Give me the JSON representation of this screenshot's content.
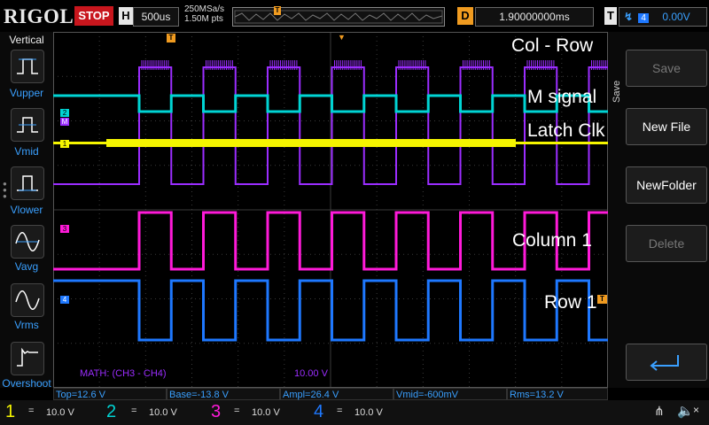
{
  "topbar": {
    "logo": "RIGOL",
    "run_state": "STOP",
    "timebase_tag": "H",
    "timebase_value": "500us",
    "sample_rate": "250MSa/s",
    "memory_depth": "1.50M pts",
    "delay_tag": "D",
    "delay_value": "1.90000000ms",
    "trigger_tag": "T",
    "trigger_channel": "4",
    "trigger_level": "0.00V"
  },
  "left_menu": {
    "title": "Vertical",
    "items": [
      {
        "label": "Vupper",
        "icon": "vupper-icon"
      },
      {
        "label": "Vmid",
        "icon": "vmid-icon"
      },
      {
        "label": "Vlower",
        "icon": "vlower-icon"
      },
      {
        "label": "Vavg",
        "icon": "vavg-icon"
      },
      {
        "label": "Vrms",
        "icon": "vrms-icon"
      },
      {
        "label": "Overshoot",
        "icon": "overshoot-icon"
      }
    ]
  },
  "right_menu": {
    "section_label": "Save",
    "save": "Save",
    "new_file": "New File",
    "new_folder": "NewFolder",
    "delete": "Delete"
  },
  "plot": {
    "math_label": "MATH: (CH3 - CH4)",
    "math_scale": "10.00 V",
    "annotations": {
      "col_row": "Col - Row",
      "m_signal": "M signal",
      "latch_clk": "Latch Clk",
      "column1": "Column 1",
      "row1": "Row 1"
    },
    "channel_markers": [
      "2",
      "M",
      "1",
      "3",
      "4"
    ],
    "trigger_marker": "T",
    "colors": {
      "ch1": "#f5f500",
      "ch2": "#00d4d4",
      "ch3": "#ff1ad9",
      "ch4": "#1e78ff",
      "math": "#9b2dff",
      "grid": "#3a3a3a"
    }
  },
  "measurements": {
    "top": "Top=12.6 V",
    "base": "Base=-13.8 V",
    "ampl": "Ampl=26.4 V",
    "vmid": "Vmid=-600mV",
    "rms": "Rms=13.2 V"
  },
  "channels": [
    {
      "num": "1",
      "coupling": "=",
      "scale": "10.0 V",
      "color": "#f5f500"
    },
    {
      "num": "2",
      "coupling": "=",
      "scale": "10.0 V",
      "color": "#00d4d4"
    },
    {
      "num": "3",
      "coupling": "=",
      "scale": "10.0 V",
      "color": "#ff1ad9"
    },
    {
      "num": "4",
      "coupling": "=",
      "scale": "10.0 V",
      "color": "#1e78ff"
    }
  ]
}
